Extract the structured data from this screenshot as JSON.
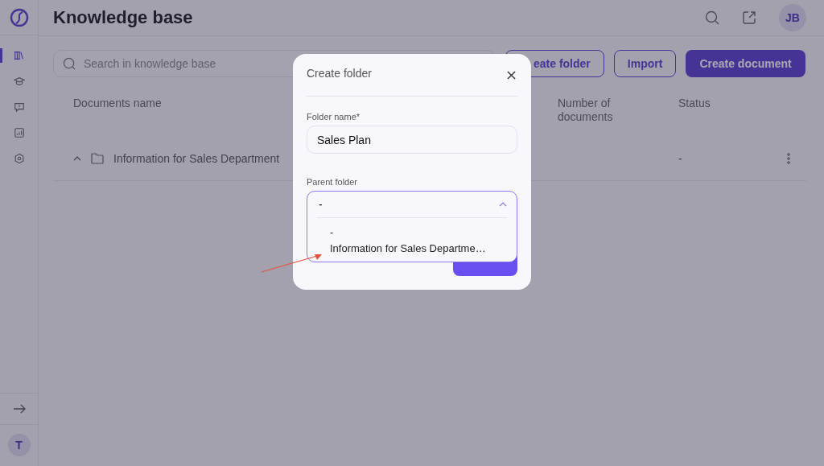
{
  "sidebar": {
    "nav_items": [
      {
        "kind": "library",
        "selected": true
      },
      {
        "kind": "course",
        "selected": false
      },
      {
        "kind": "question",
        "selected": false
      },
      {
        "kind": "report",
        "selected": false
      },
      {
        "kind": "settings",
        "selected": false
      }
    ],
    "user_avatar": "T"
  },
  "header": {
    "title": "Knowledge base",
    "user_avatar": "JB"
  },
  "toolbar": {
    "search": {
      "placeholder": "Search in knowledge base"
    },
    "buttons": [
      {
        "label": "eate folder",
        "kind": "outline"
      },
      {
        "label": "Import",
        "kind": "outline"
      },
      {
        "label": "Create document",
        "kind": "primary"
      }
    ]
  },
  "table": {
    "columns": [
      "Documents name",
      "Number of documents",
      "Status"
    ],
    "rows": [
      {
        "name": "Information for Sales Department",
        "expanded": true,
        "documents": "",
        "status": "-"
      }
    ]
  },
  "dialog": {
    "title": "Create folder",
    "folder_name": {
      "label": "Folder name*",
      "value": "Sales Plan"
    },
    "parent_folder": {
      "label": "Parent folder",
      "value": "-",
      "expanded": true,
      "options": [
        "-",
        "Information for Sales Departme…"
      ]
    }
  }
}
